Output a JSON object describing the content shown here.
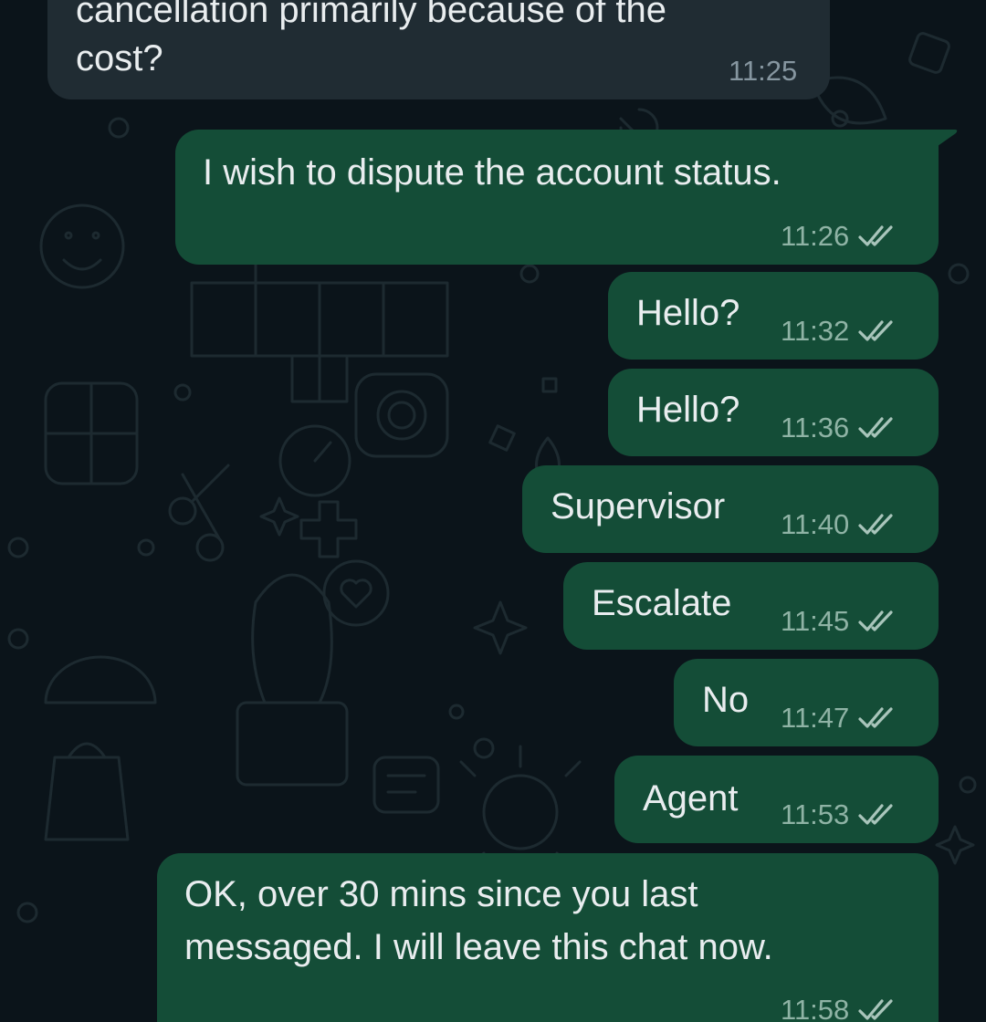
{
  "conversation": {
    "messages": [
      {
        "direction": "incoming",
        "lines": [
          "cancellation primarily because of the",
          "cost?"
        ],
        "time": "11:25"
      },
      {
        "direction": "outgoing",
        "text": "I wish to dispute the account status.",
        "time": "11:26",
        "status_icon": "double-check-icon"
      },
      {
        "direction": "outgoing",
        "text": "Hello?",
        "time": "11:32",
        "status_icon": "double-check-icon"
      },
      {
        "direction": "outgoing",
        "text": "Hello?",
        "time": "11:36",
        "status_icon": "double-check-icon"
      },
      {
        "direction": "outgoing",
        "text": "Supervisor",
        "time": "11:40",
        "status_icon": "double-check-icon"
      },
      {
        "direction": "outgoing",
        "text": "Escalate",
        "time": "11:45",
        "status_icon": "double-check-icon"
      },
      {
        "direction": "outgoing",
        "text": "No",
        "time": "11:47",
        "status_icon": "double-check-icon"
      },
      {
        "direction": "outgoing",
        "text": "Agent",
        "time": "11:53",
        "status_icon": "double-check-icon"
      },
      {
        "direction": "outgoing",
        "lines": [
          "OK, over 30 mins since you last",
          "messaged. I will leave this chat now."
        ],
        "time": "11:58",
        "status_icon": "double-check-icon"
      }
    ]
  },
  "colors": {
    "background": "#0b141a",
    "incoming_bubble": "#202c33",
    "outgoing_bubble": "#144d37",
    "text": "#e9edef",
    "outgoing_meta": "#8fb3a5",
    "incoming_meta": "#8696a0",
    "tick_color": "#a9c5bb"
  }
}
